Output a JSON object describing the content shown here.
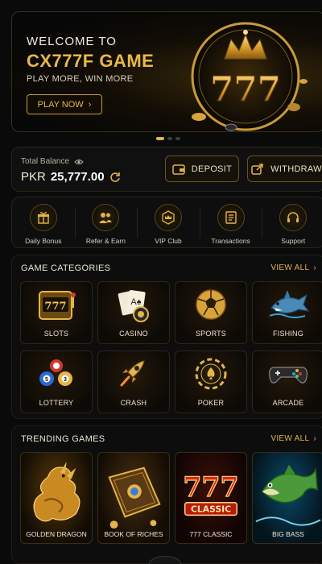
{
  "hero": {
    "line1": "WELCOME TO",
    "line2": "CX777F GAME",
    "subtitle": "PLAY MORE, WIN MORE",
    "cta_label": "PLAY NOW",
    "emblem_text": "777"
  },
  "carousel": {
    "count": 3,
    "active": 0
  },
  "balance": {
    "label": "Total Balance",
    "currency": "PKR",
    "amount": "25,777.00",
    "deposit_label": "DEPOSIT",
    "withdraw_label": "WITHDRAW"
  },
  "quick_actions": [
    {
      "label": "Daily Bonus",
      "icon": "gift-icon"
    },
    {
      "label": "Refer & Earn",
      "icon": "users-icon"
    },
    {
      "label": "VIP Club",
      "icon": "crown-icon"
    },
    {
      "label": "Transactions",
      "icon": "receipt-icon"
    },
    {
      "label": "Support",
      "icon": "headset-icon"
    }
  ],
  "categories": {
    "title": "GAME CATEGORIES",
    "view_all": "VIEW ALL",
    "items": [
      {
        "label": "SLOTS",
        "icon": "slot-machine-icon"
      },
      {
        "label": "CASINO",
        "icon": "cards-icon"
      },
      {
        "label": "SPORTS",
        "icon": "soccer-ball-icon"
      },
      {
        "label": "FISHING",
        "icon": "shark-icon"
      },
      {
        "label": "LOTTERY",
        "icon": "lottery-balls-icon"
      },
      {
        "label": "CRASH",
        "icon": "rocket-icon"
      },
      {
        "label": "POKER",
        "icon": "poker-chip-icon"
      },
      {
        "label": "ARCADE",
        "icon": "gamepad-icon"
      }
    ]
  },
  "trending": {
    "title": "TRENDING GAMES",
    "view_all": "VIEW ALL",
    "items": [
      {
        "label": "GOLDEN DRAGON"
      },
      {
        "label": "BOOK OF RICHES"
      },
      {
        "label": "777 CLASSIC",
        "art_text": "777",
        "art_sub": "CLASSIC"
      },
      {
        "label": "BIG BASS"
      }
    ]
  }
}
